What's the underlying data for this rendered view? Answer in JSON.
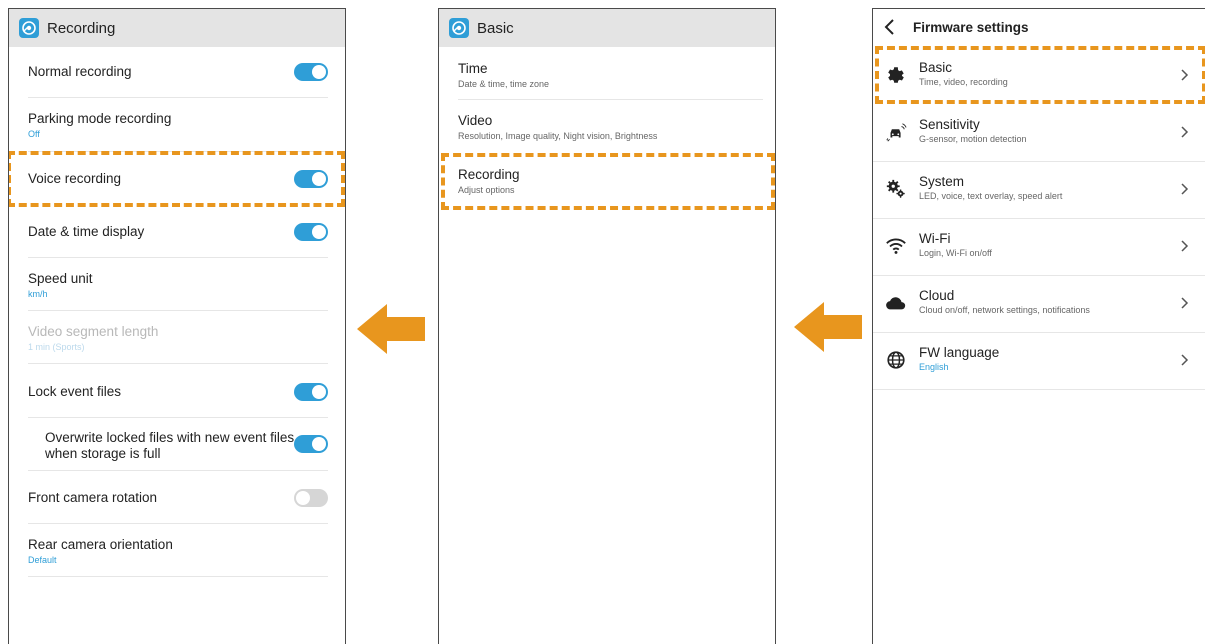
{
  "recording_panel": {
    "title": "Recording",
    "items": [
      {
        "label": "Normal recording",
        "toggle": true
      },
      {
        "label": "Parking mode recording",
        "value": "Off"
      },
      {
        "label": "Voice recording",
        "toggle": true
      },
      {
        "label": "Date & time display",
        "toggle": true
      },
      {
        "label": "Speed unit",
        "value": "km/h"
      },
      {
        "label": "Video segment length",
        "value": "1 min (Sports)",
        "disabled": true
      },
      {
        "label": "Lock event files",
        "toggle": true
      },
      {
        "label": "Overwrite locked files with new event files when storage is full",
        "toggle": true
      },
      {
        "label": "Front camera rotation",
        "toggle": false
      },
      {
        "label": "Rear camera orientation",
        "value": "Default"
      }
    ]
  },
  "basic_panel": {
    "title": "Basic",
    "items": [
      {
        "label": "Time",
        "sub": "Date & time, time zone"
      },
      {
        "label": "Video",
        "sub": "Resolution, Image quality, Night vision, Brightness"
      },
      {
        "label": "Recording",
        "sub": "Adjust options"
      }
    ]
  },
  "firmware_panel": {
    "title": "Firmware settings",
    "items": [
      {
        "label": "Basic",
        "sub": "Time, video, recording",
        "icon": "gear-icon"
      },
      {
        "label": "Sensitivity",
        "sub": "G-sensor, motion detection",
        "icon": "car-impact-icon"
      },
      {
        "label": "System",
        "sub": "LED, voice, text overlay, speed alert",
        "icon": "gears-icon"
      },
      {
        "label": "Wi-Fi",
        "sub": "Login, Wi-Fi on/off",
        "icon": "wifi-icon"
      },
      {
        "label": "Cloud",
        "sub": "Cloud on/off, network settings, notifications",
        "icon": "cloud-icon"
      },
      {
        "label": "FW language",
        "sub": "English",
        "icon": "globe-icon"
      }
    ]
  },
  "colors": {
    "accent": "#2f9ed7",
    "highlight": "#e8961e",
    "header_bg": "#e4e4e4"
  }
}
